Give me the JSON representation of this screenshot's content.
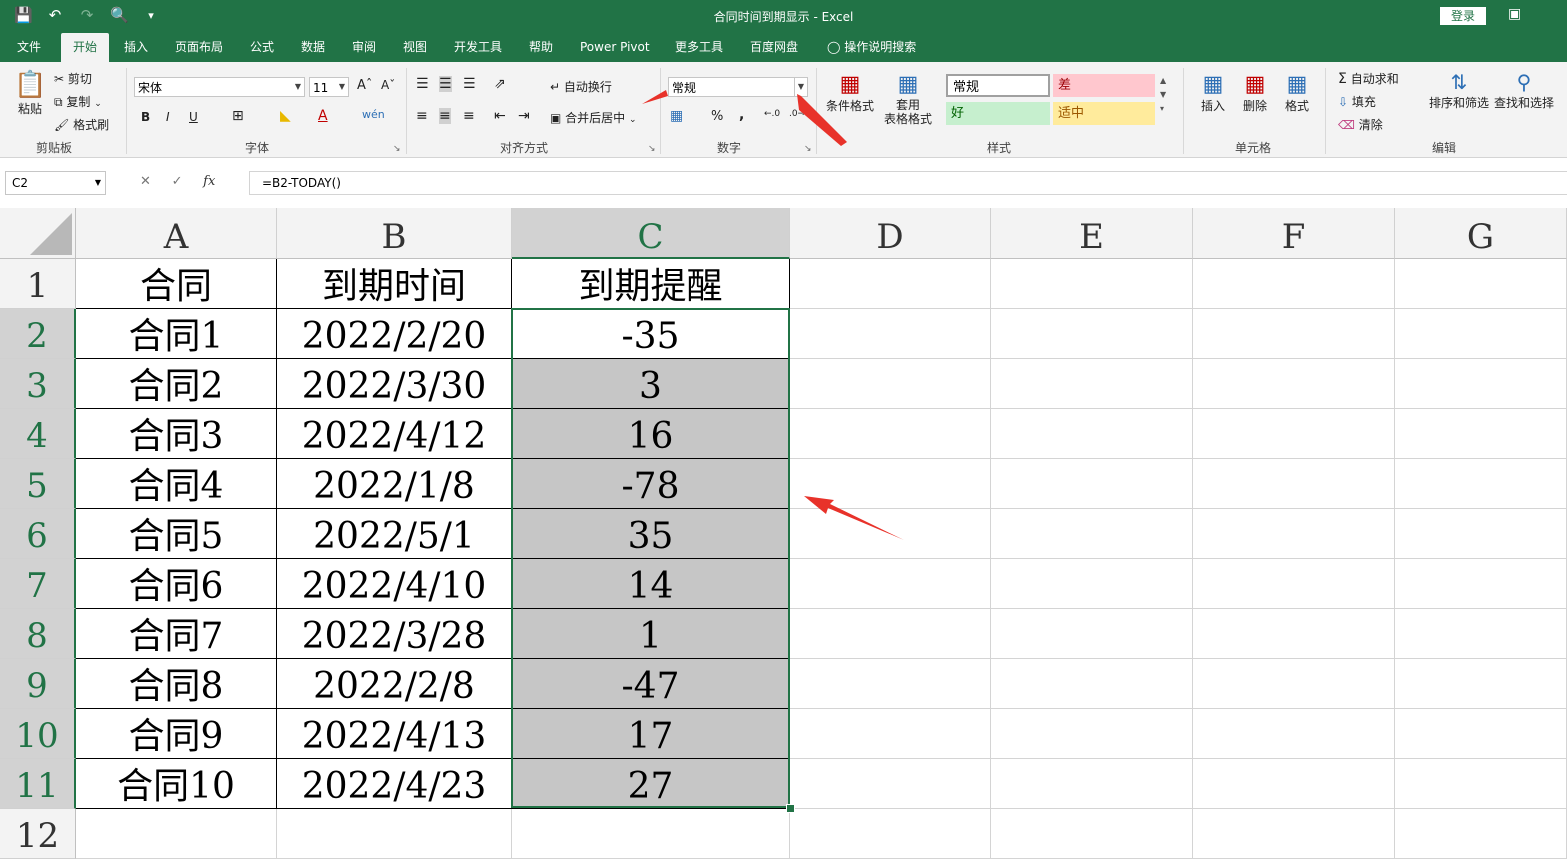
{
  "window": {
    "title": "合同时间到期显示  -  Excel",
    "login": "登录"
  },
  "qat": {
    "save": "save-icon",
    "undo": "undo-icon",
    "redo": "redo-icon",
    "preview": "print-preview-icon",
    "customize": "customize-icon"
  },
  "tabs": [
    "文件",
    "开始",
    "插入",
    "页面布局",
    "公式",
    "数据",
    "审阅",
    "视图",
    "开发工具",
    "帮助",
    "Power Pivot",
    "更多工具",
    "百度网盘",
    "操作说明搜索"
  ],
  "active_tab": "开始",
  "ribbon": {
    "clipboard": {
      "label": "剪贴板",
      "paste": "粘贴",
      "cut": "剪切",
      "copy": "复制",
      "format_painter": "格式刷"
    },
    "font": {
      "label": "字体",
      "name": "宋体",
      "size": "11",
      "bold": "B",
      "italic": "I",
      "underline": "U"
    },
    "alignment": {
      "label": "对齐方式",
      "wrap": "自动换行",
      "merge": "合并后居中"
    },
    "number": {
      "label": "数字",
      "format": "常规",
      "percent": "%",
      "comma": ","
    },
    "styles": {
      "label": "样式",
      "conditional": "条件格式",
      "table1": "套用",
      "table2": "表格格式",
      "normal": "常规",
      "bad": "差",
      "good": "好",
      "neutral": "适中"
    },
    "cells": {
      "label": "单元格",
      "insert": "插入",
      "delete": "删除",
      "format": "格式"
    },
    "editing": {
      "label": "编辑",
      "autosum": "自动求和",
      "fill": "填充",
      "clear": "清除",
      "sort": "排序和筛选",
      "find": "查找和选择"
    }
  },
  "formula_bar": {
    "name_box": "C2",
    "fx": "fx",
    "formula": "=B2-TODAY()"
  },
  "columns": [
    "A",
    "B",
    "C",
    "D",
    "E",
    "F",
    "G"
  ],
  "rows": [
    "1",
    "2",
    "3",
    "4",
    "5",
    "6",
    "7",
    "8",
    "9",
    "10",
    "11",
    "12"
  ],
  "sheet": {
    "header": [
      "合同",
      "到期时间",
      "到期提醒"
    ],
    "data": [
      [
        "合同1",
        "2022/2/20",
        "-35"
      ],
      [
        "合同2",
        "2022/3/30",
        "3"
      ],
      [
        "合同3",
        "2022/4/12",
        "16"
      ],
      [
        "合同4",
        "2022/1/8",
        "-78"
      ],
      [
        "合同5",
        "2022/5/1",
        "35"
      ],
      [
        "合同6",
        "2022/4/10",
        "14"
      ],
      [
        "合同7",
        "2022/3/28",
        "1"
      ],
      [
        "合同8",
        "2022/2/8",
        "-47"
      ],
      [
        "合同9",
        "2022/4/13",
        "17"
      ],
      [
        "合同10",
        "2022/4/23",
        "27"
      ]
    ]
  },
  "colors": {
    "excel_green": "#217346",
    "arrow": "#e8322a",
    "bad_bg": "#ffc7ce",
    "good_bg": "#c6efce",
    "neutral_bg": "#ffeb9c"
  }
}
